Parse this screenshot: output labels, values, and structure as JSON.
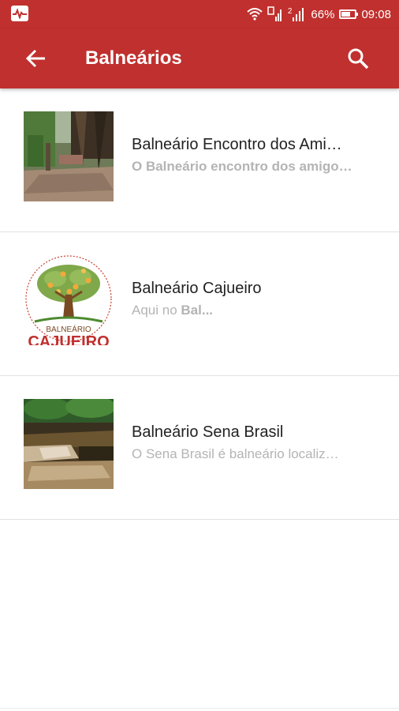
{
  "status_bar": {
    "battery_percent": "66%",
    "time": "09:08",
    "sim_label": "2",
    "battery_level": 0.66
  },
  "app_bar": {
    "title": "Balneários",
    "background_color": "#c0302e",
    "back_icon": "arrow-back-icon",
    "search_icon": "search-icon"
  },
  "list": {
    "items": [
      {
        "title": "Balneário Encontro dos Ami…",
        "subtitle": "O Balneário encontro dos amigo…",
        "subtitle_bold": true,
        "thumbnail": "forest-path-photo"
      },
      {
        "title": "Balneário Cajueiro",
        "subtitle_plain": "Aqui no ",
        "subtitle_bold_part": "Bal...",
        "thumbnail": "cashew-tree-logo",
        "logo_text_top": "BALNEÁRIO",
        "logo_text_bottom": "CAJUEIRO"
      },
      {
        "title": "Balneário Sena Brasil",
        "subtitle": "O Sena Brasil é balneário localiz…",
        "subtitle_bold": false,
        "thumbnail": "river-waterfall-photo"
      }
    ]
  }
}
